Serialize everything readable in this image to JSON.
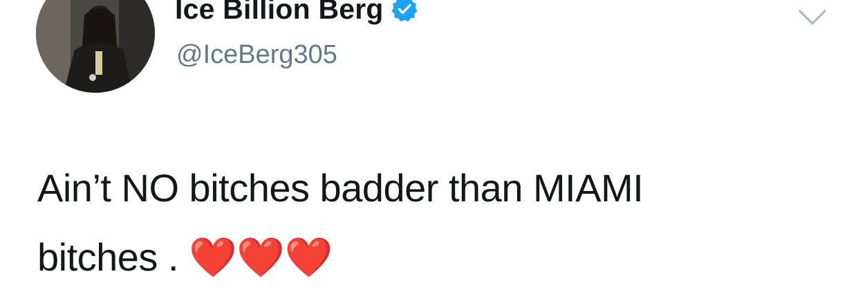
{
  "author": {
    "display_name": "Ice Billion Berg",
    "handle": "@IceBerg305",
    "verified": true,
    "avatar_icon": "user-avatar-photo"
  },
  "tweet": {
    "line1": "Ain’t NO bitches badder than MIAMI",
    "line2": "bitches .",
    "emoji": "❤️❤️❤️"
  },
  "icons": {
    "verified_badge": "verified-badge-icon",
    "more_menu": "chevron-down-icon"
  },
  "colors": {
    "verified_blue": "#1da1f2",
    "handle_gray": "#657786",
    "text": "#14171a",
    "caret_gray": "#aab8c2",
    "heart_red": "#e0245e"
  }
}
